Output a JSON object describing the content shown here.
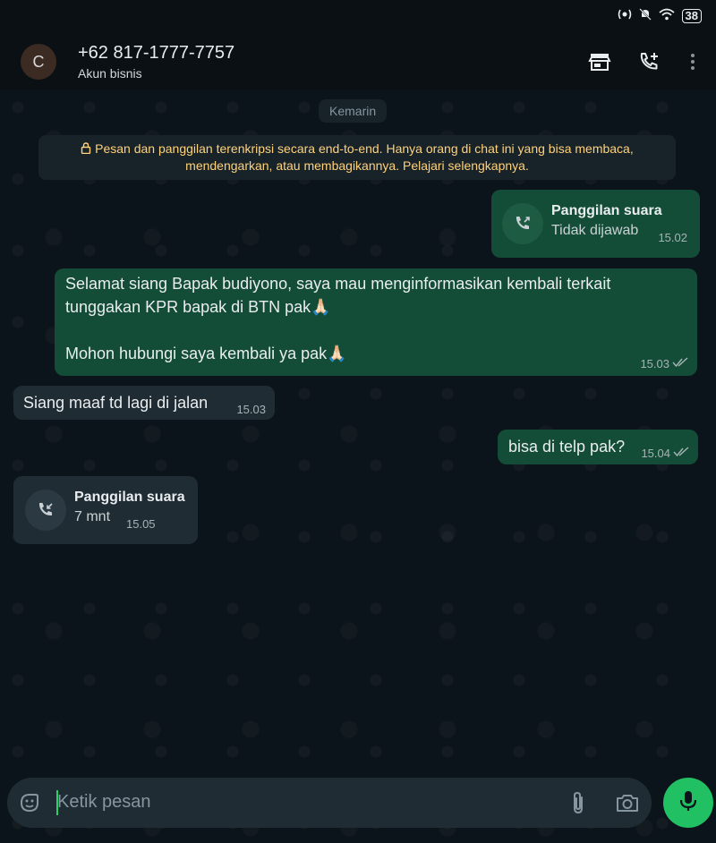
{
  "status_bar": {
    "battery": "38"
  },
  "header": {
    "avatar_letter": "C",
    "contact_name": "+62 817-1777-7757",
    "subtitle": "Akun bisnis",
    "icons": [
      "store-icon",
      "add-call-icon",
      "more-vert-icon"
    ]
  },
  "chat": {
    "date_chip": "Kemarin",
    "encryption_notice": "Pesan dan panggilan terenkripsi secara end-to-end. Hanya orang di chat ini yang bisa membaca, mendengarkan, atau membagikannya. Pelajari selengkapnya.",
    "messages": [
      {
        "type": "call",
        "direction": "out",
        "title": "Panggilan suara",
        "subtitle": "Tidak dijawab",
        "time": "15.02"
      },
      {
        "type": "text",
        "direction": "out",
        "text": "Selamat siang Bapak budiyono, saya mau menginformasikan kembali terkait tunggakan KPR bapak di BTN pak🙏🏻\n\nMohon hubungi saya kembali ya pak🙏🏻",
        "time": "15.03",
        "status": "read"
      },
      {
        "type": "text",
        "direction": "in",
        "text": "Siang maaf td lagi di jalan",
        "time": "15.03"
      },
      {
        "type": "text",
        "direction": "out",
        "text": "bisa di telp pak?",
        "time": "15.04",
        "status": "read"
      },
      {
        "type": "call",
        "direction": "in",
        "title": "Panggilan suara",
        "subtitle": "7 mnt",
        "time": "15.05"
      }
    ]
  },
  "composer": {
    "placeholder": "Ketik pesan",
    "icons": [
      "sticker-icon",
      "attach-icon",
      "camera-icon",
      "mic-icon"
    ]
  },
  "colors": {
    "outgoing_bubble": "#144d37",
    "incoming_bubble": "#202c33",
    "accent_green": "#21c063",
    "notice_yellow": "#ffd279"
  }
}
